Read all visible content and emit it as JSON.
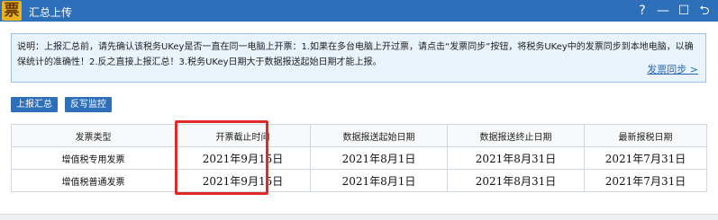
{
  "window": {
    "logo_char": "票",
    "title": "汇总上传",
    "controls": {
      "help": "?",
      "minimize": "—",
      "maximize": "☐",
      "restore": "⮌"
    }
  },
  "notice": {
    "text": "说明：上报汇总前，请先确认该税务UKey是否一直在同一电脑上开票：1.如果在多台电脑上开过票，请点击“发票同步”按钮，将税务UKey中的发票同步到本地电脑，以确保统计的准确性！2.反之直接上报汇总！3.税务UKey日期大于数据报送起始日期才能上报。",
    "sync_link": "发票同步 >"
  },
  "toolbar": {
    "report_label": "上报汇总",
    "monitor_label": "反写监控"
  },
  "table": {
    "headers": [
      "发票类型",
      "开票截止时间",
      "数据报送起始日期",
      "数据报送终止日期",
      "最新报税日期"
    ],
    "rows": [
      [
        "增值税专用发票",
        "2021年9月15日",
        "2021年8月1日",
        "2021年8月31日",
        "2021年7月31日"
      ],
      [
        "增值税普通发票",
        "2021年9月15日",
        "2021年8月1日",
        "2021年8月31日",
        "2021年7月31日"
      ]
    ]
  },
  "colors": {
    "titlebar": "#2d6fb8",
    "highlight": "#e02a27",
    "link": "#2466b0"
  }
}
